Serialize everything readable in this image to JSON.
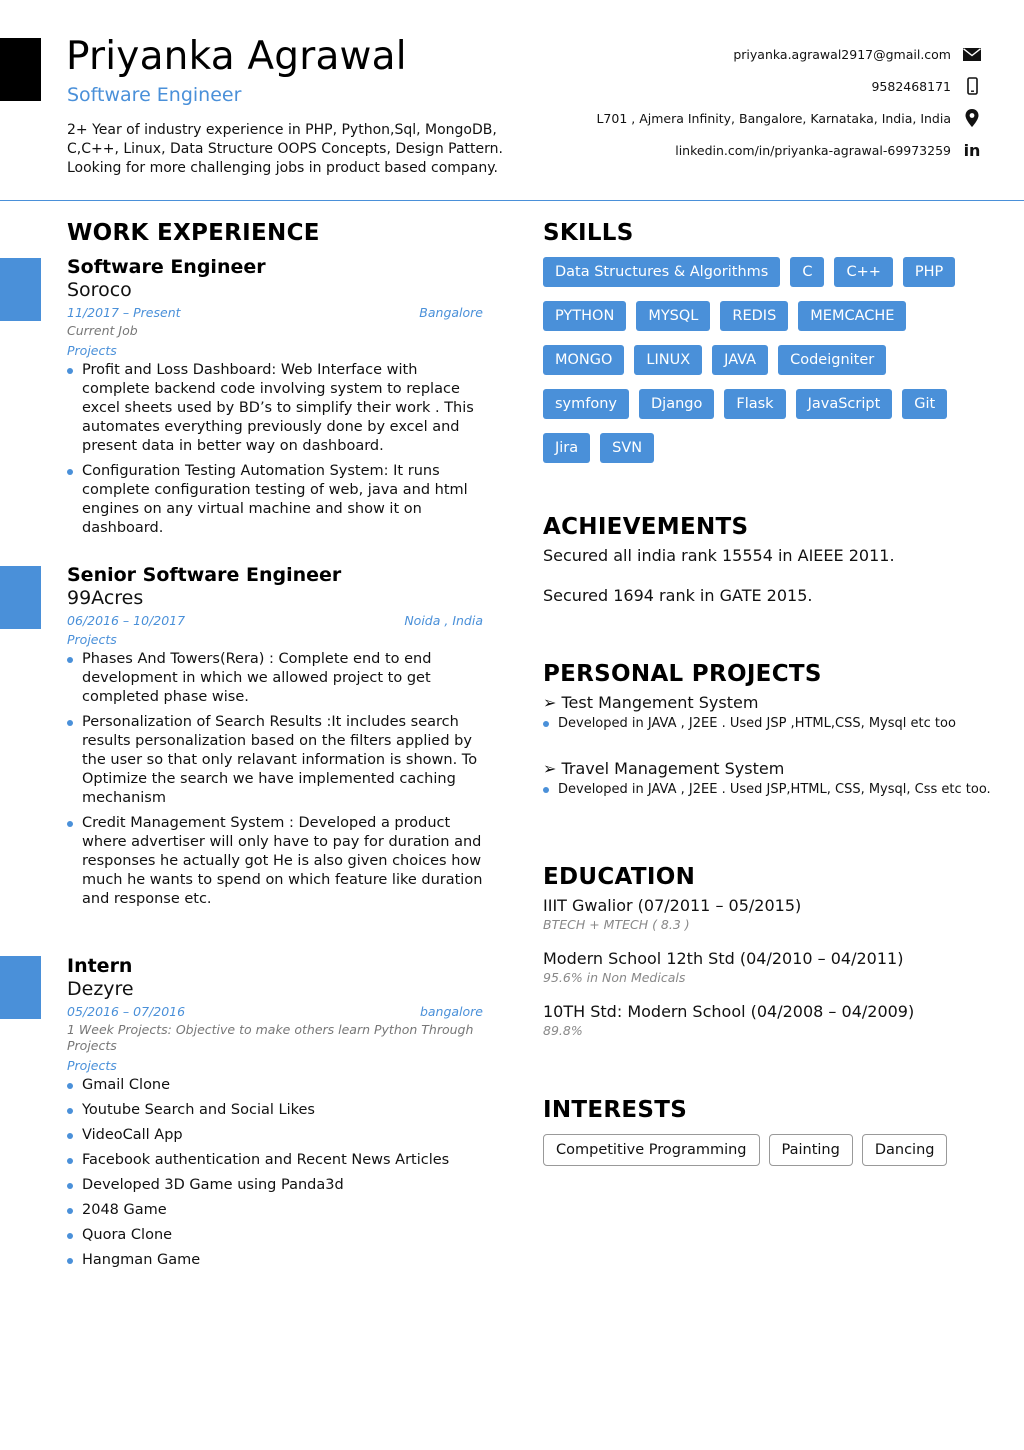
{
  "header": {
    "name": "Priyanka Agrawal",
    "title": "Software Engineer",
    "summary": "2+ Year of industry experience in PHP, Python,Sql, MongoDB, C,C++, Linux, Data Structure OOPS Concepts, Design Pattern. Looking for more challenging jobs in product based company."
  },
  "contact": {
    "email": "priyanka.agrawal2917@gmail.com",
    "phone": "9582468171",
    "address": "L701 , Ajmera Infinity, Bangalore, Karnataka, India, India",
    "linkedin": "linkedin.com/in/priyanka-agrawal-69973259",
    "linkedin_icon_text": "in"
  },
  "work": {
    "heading": "WORK EXPERIENCE",
    "jobs": [
      {
        "title": "Software Engineer",
        "company": "Soroco",
        "dates": "11/2017 – Present",
        "location": "Bangalore",
        "note": "Current Job",
        "projects_label": "Projects",
        "bullets": [
          "Profit and Loss Dashboard: Web Interface with complete backend code involving system to replace excel sheets used by BD’s to simplify their work . This automates everything previously done by excel and present data in better way on dashboard.",
          "Configuration Testing Automation System: It runs complete configuration testing of web, java and html engines on any virtual machine and show it on dashboard."
        ]
      },
      {
        "title": "Senior Software Engineer",
        "company": "99Acres",
        "dates": "06/2016 – 10/2017",
        "location": "Noida , India",
        "projects_label": "Projects",
        "bullets": [
          "Phases And Towers(Rera) : Complete end to end development in which we allowed project to get completed phase wise.",
          "Personalization of Search Results :It includes search results personalization based on the filters applied by the user so that only relavant information is shown. To Optimize the search we have implemented caching mechanism",
          "Credit Management System : Developed a product where advertiser will only have to pay for duration and responses he actually got He is also given choices how much he wants to spend on which feature like duration and response etc."
        ]
      },
      {
        "title": "Intern",
        "company": "Dezyre",
        "dates": "05/2016 – 07/2016",
        "location": "bangalore",
        "note": "1 Week Projects: Objective to make others learn Python Through Projects",
        "projects_label": "Projects",
        "bullets": [
          "Gmail Clone",
          "Youtube Search and Social Likes",
          "VideoCall App",
          "Facebook authentication and Recent News Articles",
          "Developed 3D Game using Panda3d",
          "2048 Game",
          "Quora Clone",
          "Hangman Game"
        ]
      }
    ]
  },
  "skills": {
    "heading": "SKILLS",
    "items": [
      "Data Structures & Algorithms",
      "C",
      "C++",
      "PHP",
      "PYTHON",
      "MYSQL",
      "REDIS",
      "MEMCACHE",
      "MONGO",
      "LINUX",
      "JAVA",
      "Codeigniter",
      "symfony",
      "Django",
      "Flask",
      "JavaScript",
      "Git",
      "Jira",
      "SVN"
    ]
  },
  "achievements": {
    "heading": "ACHIEVEMENTS",
    "items": [
      "Secured all india rank 15554 in AIEEE 2011.",
      "Secured 1694 rank in GATE 2015."
    ]
  },
  "projects": {
    "heading": "PERSONAL PROJECTS",
    "items": [
      {
        "name": "➢ Test Mangement System",
        "detail": "Developed in JAVA , J2EE . Used JSP ,HTML,CSS, Mysql etc too"
      },
      {
        "name": "➢ Travel Management System",
        "detail": "Developed in JAVA , J2EE . Used JSP,HTML, CSS, Mysql, Css etc too."
      }
    ]
  },
  "education": {
    "heading": "EDUCATION",
    "items": [
      {
        "name": "IIIT Gwalior (07/2011 – 05/2015)",
        "sub": "BTECH + MTECH ( 8.3 )"
      },
      {
        "name": "Modern School 12th Std (04/2010 – 04/2011)",
        "sub": "95.6% in Non Medicals"
      },
      {
        "name": "10TH Std: Modern School (04/2008 – 04/2009)",
        "sub": "89.8%"
      }
    ]
  },
  "interests": {
    "heading": "INTERESTS",
    "items": [
      "Competitive Programming",
      "Painting",
      "Dancing"
    ]
  },
  "colors": {
    "accent": "#4a90d9",
    "block": "#000000"
  }
}
